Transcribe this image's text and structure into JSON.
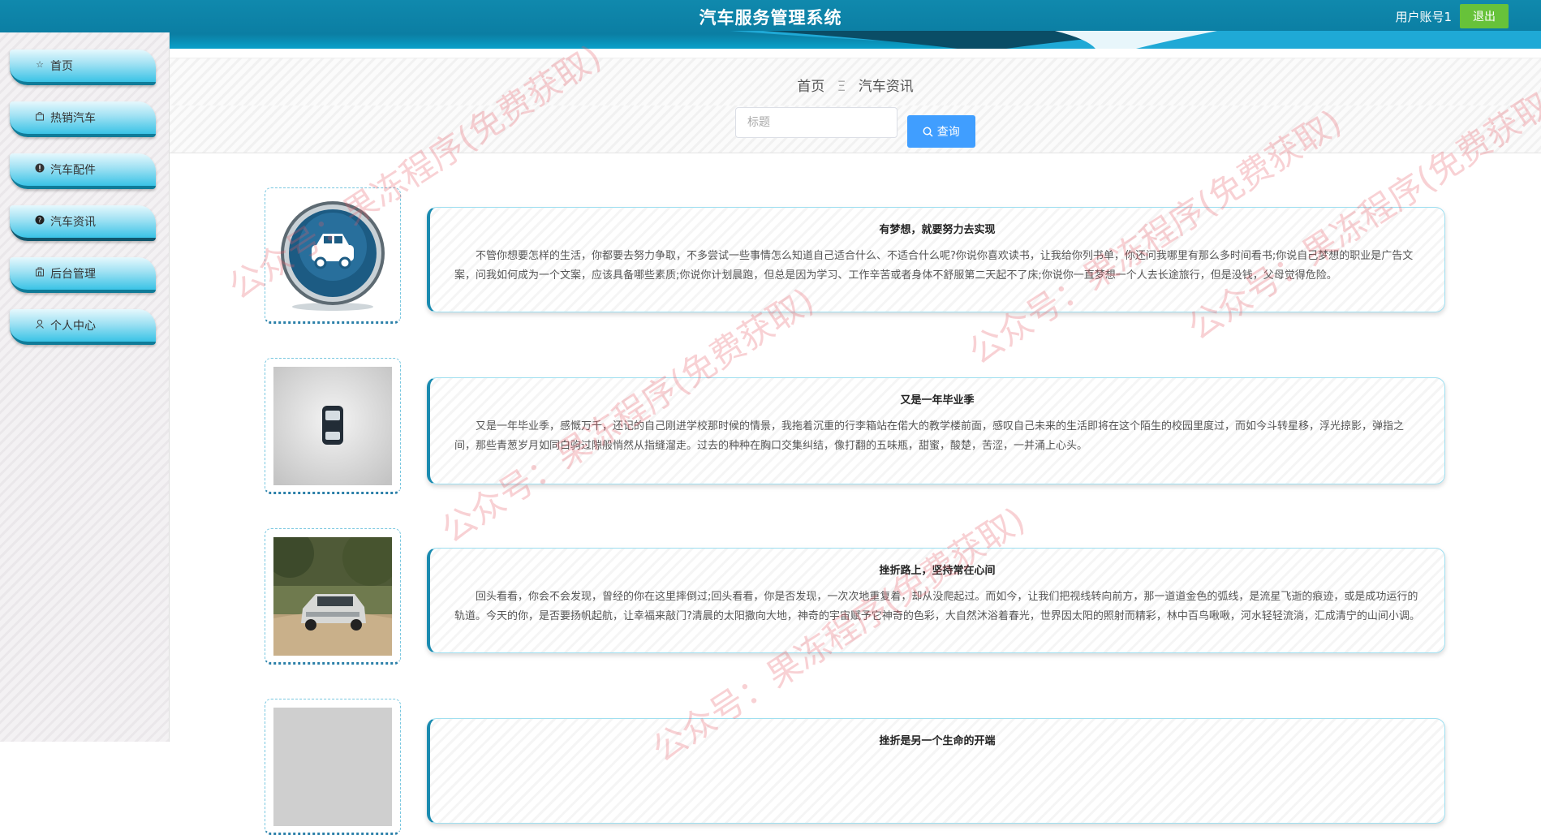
{
  "header": {
    "title": "汽车服务管理系统",
    "user_label": "用户账号1",
    "logout_label": "退出"
  },
  "sidebar": {
    "items": [
      {
        "label": "首页",
        "icon": "star-icon"
      },
      {
        "label": "热销汽车",
        "icon": "bag-icon"
      },
      {
        "label": "汽车配件",
        "icon": "info-icon"
      },
      {
        "label": "汽车资讯",
        "icon": "question-icon",
        "active": true
      },
      {
        "label": "后台管理",
        "icon": "building-icon"
      },
      {
        "label": "个人中心",
        "icon": "user-icon"
      }
    ]
  },
  "breadcrumb": {
    "home": "首页",
    "separator": "Ξ",
    "current": "汽车资讯"
  },
  "search": {
    "placeholder": "标题",
    "button_label": "查询"
  },
  "articles": [
    {
      "title": "有梦想，就要努力去实现",
      "content": "不管你想要怎样的生活，你都要去努力争取，不多尝试一些事情怎么知道自己适合什么、不适合什么呢?你说你喜欢读书，让我给你列书单，你还问我哪里有那么多时间看书;你说自己梦想的职业是广告文案，问我如何成为一个文案，应该具备哪些素质;你说你计划晨跑，但总是因为学习、工作辛苦或者身体不舒服第二天起不了床;你说你一直梦想一个人去长途旅行，但是没钱，父母觉得危险。",
      "image": "car-button-icon"
    },
    {
      "title": "又是一年毕业季",
      "content": "又是一年毕业季，感慨万千，还记的自己刚进学校那时候的情景，我拖着沉重的行李箱站在偌大的教学楼前面，感叹自己未来的生活即将在这个陌生的校园里度过，而如今斗转星移，浮光掠影，弹指之间，那些青葱岁月如同白驹过隙般悄然从指缝溜走。过去的种种在胸口交集纠结，像打翻的五味瓶，甜蜜，酸楚，苦涩，一并涌上心头。",
      "image": "car-top-view-icon"
    },
    {
      "title": "挫折路上，坚持常在心间",
      "content": "回头看看，你会不会发现，曾经的你在这里摔倒过;回头看看，你是否发现，一次次地重复着，却从没爬起过。而如今，让我们把视线转向前方，那一道道金色的弧线，是流星飞逝的痕迹，或是成功运行的轨道。今天的你，是否要扬帆起航，让幸福来敲门?清晨的太阳撒向大地，神奇的宇宙赋予它神奇的色彩，大自然沐浴着春光，世界因太阳的照射而精彩，林中百鸟啾啾，河水轻轻流淌，汇成清宁的山间小调。",
      "image": "suv-photo"
    },
    {
      "title": "挫折是另一个生命的开端",
      "content": "",
      "image": "gray-photo"
    }
  ],
  "watermark": "公众号：果冻程序(免费获取)",
  "colors": {
    "header": "#0b7ea3",
    "accent": "#409eff",
    "logout": "#67c23a",
    "card_border": "#1b8bb0"
  }
}
